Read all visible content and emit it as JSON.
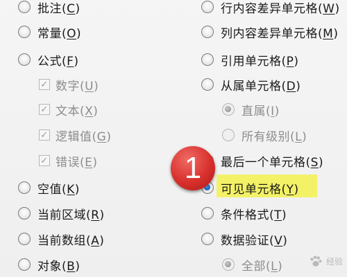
{
  "left_options": [
    {
      "text": "批注",
      "key": "C",
      "state": "unchecked",
      "enabled": true
    },
    {
      "text": "常量",
      "key": "O",
      "state": "unchecked",
      "enabled": true
    },
    {
      "text": "公式",
      "key": "F",
      "state": "unchecked",
      "enabled": true
    },
    {
      "text": "数字",
      "key": "U",
      "state": "checked",
      "enabled": false
    },
    {
      "text": "文本",
      "key": "X",
      "state": "checked",
      "enabled": false
    },
    {
      "text": "逻辑值",
      "key": "G",
      "state": "checked",
      "enabled": false
    },
    {
      "text": "错误",
      "key": "E",
      "state": "checked",
      "enabled": false
    },
    {
      "text": "空值",
      "key": "K",
      "state": "unchecked",
      "enabled": true
    },
    {
      "text": "当前区域",
      "key": "R",
      "state": "unchecked",
      "enabled": true
    },
    {
      "text": "当前数组",
      "key": "A",
      "state": "unchecked",
      "enabled": true
    },
    {
      "text": "对象",
      "key": "B",
      "state": "unchecked",
      "enabled": true
    }
  ],
  "right_options": [
    {
      "text": "行内容差异单元格",
      "key": "W",
      "state": "unchecked",
      "enabled": true
    },
    {
      "text": "列内容差异单元格",
      "key": "M",
      "state": "unchecked",
      "enabled": true
    },
    {
      "text": "引用单元格",
      "key": "P",
      "state": "unchecked",
      "enabled": true
    },
    {
      "text": "从属单元格",
      "key": "D",
      "state": "unchecked",
      "enabled": true
    },
    {
      "text": "直属",
      "key": "I",
      "state": "checked",
      "enabled": false
    },
    {
      "text": "所有级别",
      "key": "L",
      "state": "unchecked",
      "enabled": false
    },
    {
      "text": "最后一个单元格",
      "key": "S",
      "state": "unchecked",
      "enabled": true
    },
    {
      "text": "可见单元格",
      "key": "Y",
      "state": "checked",
      "enabled": true
    },
    {
      "text": "条件格式",
      "key": "T",
      "state": "unchecked",
      "enabled": true
    },
    {
      "text": "数据验证",
      "key": "V",
      "state": "unchecked",
      "enabled": true
    },
    {
      "text": "全部",
      "key": "L",
      "state": "checked",
      "enabled": false
    }
  ],
  "annotation": {
    "step_number": "1",
    "highlight_color": "#f3f267",
    "badge_color": "#d8302c"
  },
  "watermark": {
    "text": "经验"
  }
}
